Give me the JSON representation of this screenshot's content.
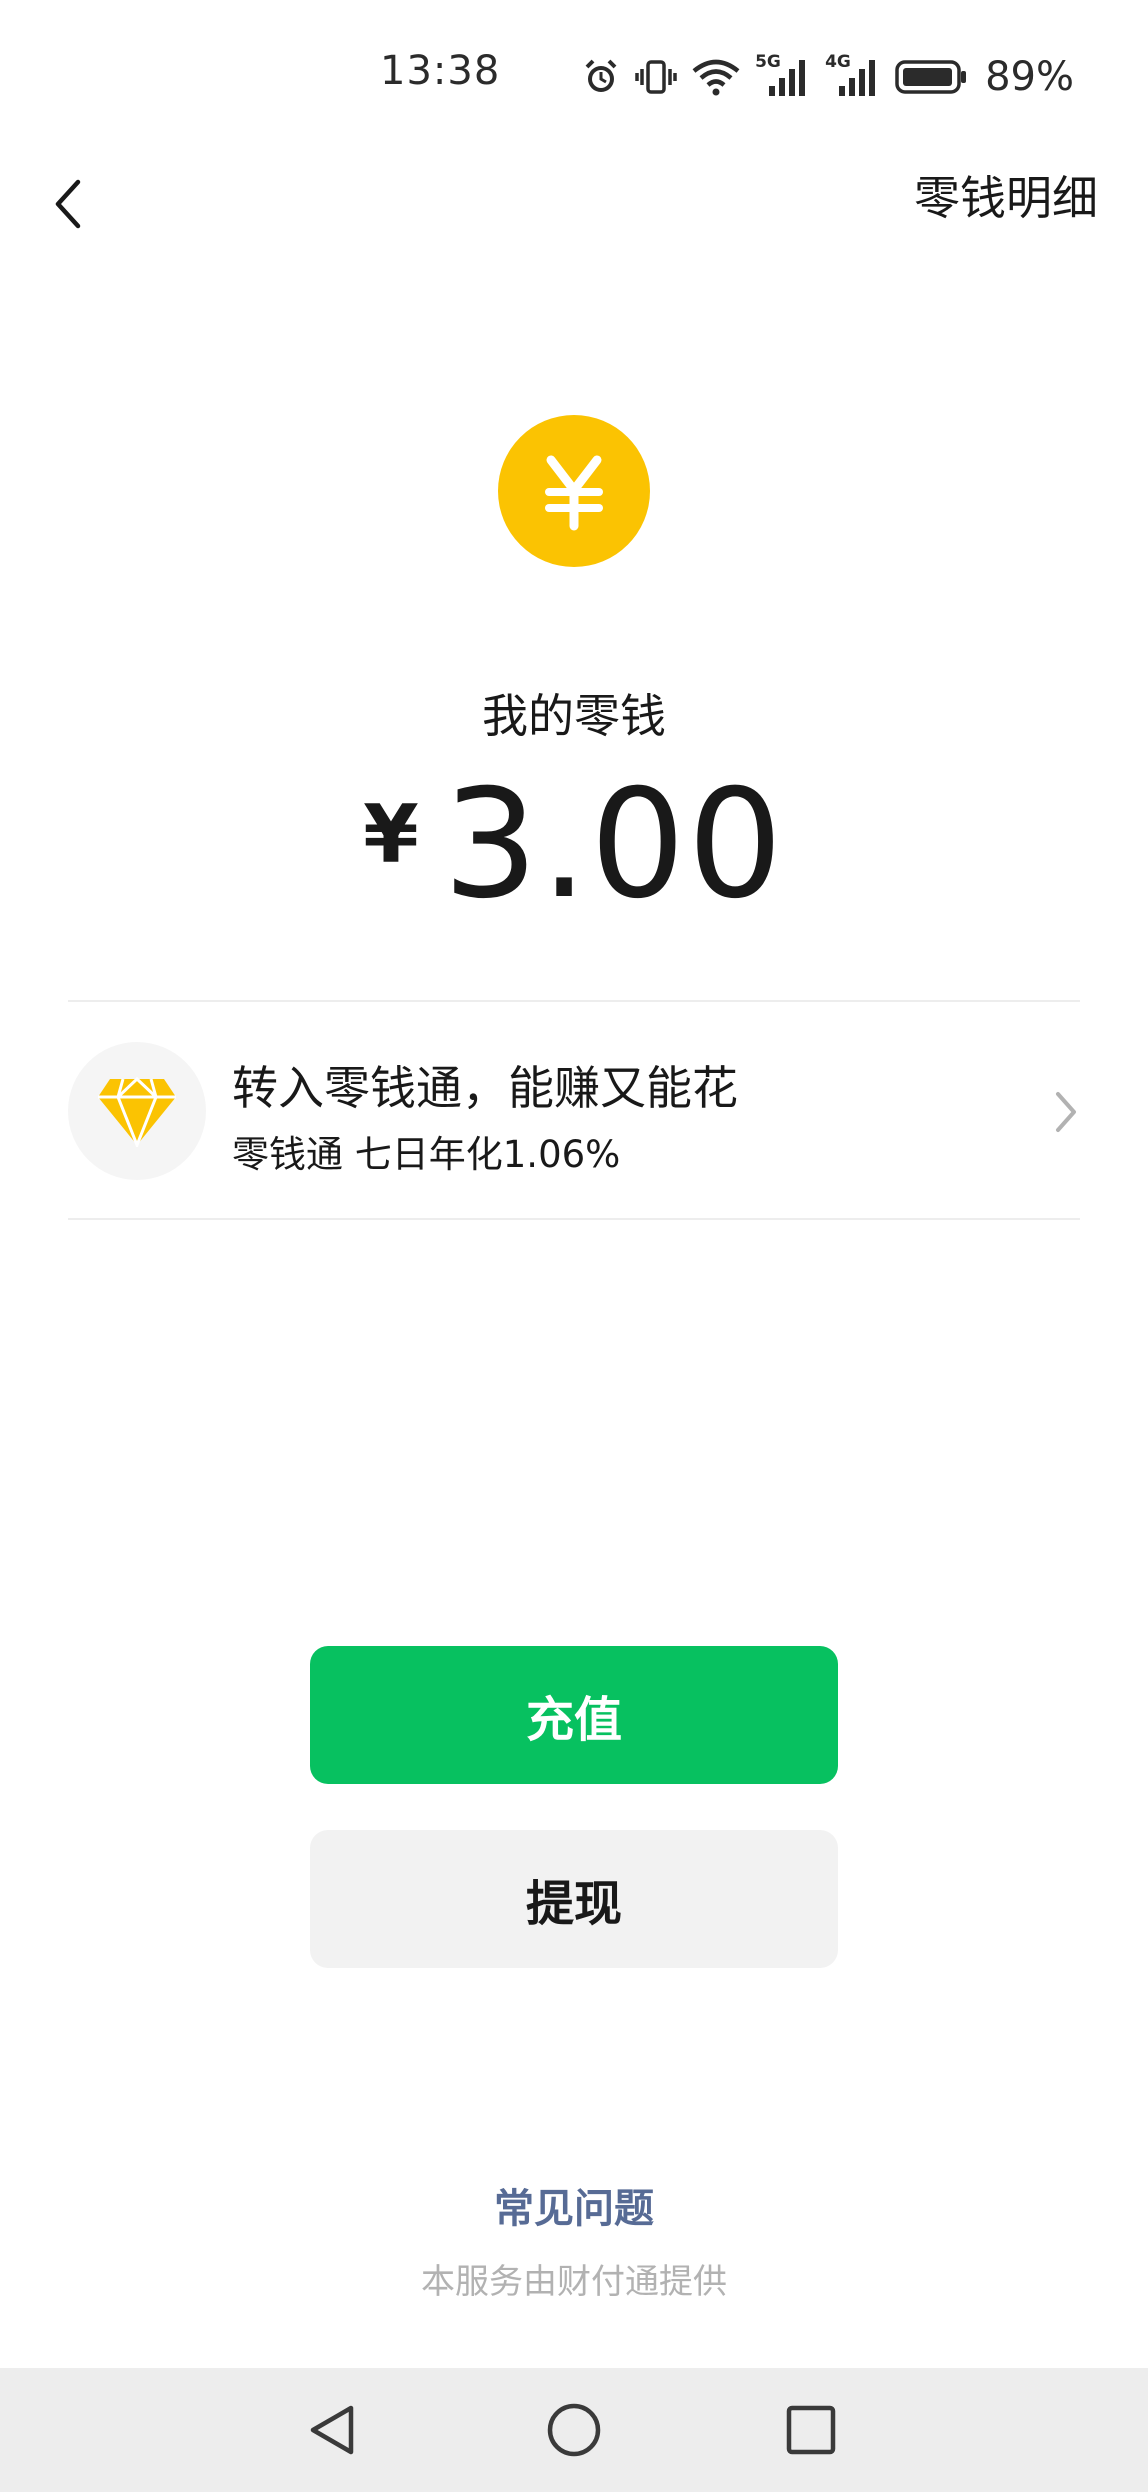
{
  "status_bar": {
    "time": "13:38",
    "network_5g": "5G",
    "network_4g": "4G",
    "battery_percent": "89%",
    "icons": [
      "alarm-icon",
      "vibrate-icon",
      "wifi-icon",
      "signal-5g-icon",
      "signal-4g-icon",
      "battery-icon"
    ]
  },
  "header": {
    "back_icon": "chevron-left-icon",
    "details_link": "零钱明细"
  },
  "balance": {
    "coin_icon": "yuan-coin-icon",
    "label": "我的零钱",
    "currency_symbol": "¥",
    "amount": "3.00"
  },
  "promo": {
    "icon": "diamond-icon",
    "title": "转入零钱通，能赚又能花",
    "subtitle": "零钱通 七日年化1.06%",
    "chevron_icon": "chevron-right-icon"
  },
  "actions": {
    "recharge_label": "充值",
    "withdraw_label": "提现"
  },
  "footer": {
    "faq_link": "常见问题",
    "provider_note": "本服务由财付通提供"
  },
  "nav_bar": {
    "icons": [
      "back-triangle-icon",
      "home-circle-icon",
      "recents-square-icon"
    ]
  },
  "colors": {
    "primary_green": "#07c160",
    "coin_yellow": "#fbc302",
    "link_blue": "#576b95",
    "secondary_button": "#f2f2f2",
    "nav_bar_bg": "#ededed"
  }
}
